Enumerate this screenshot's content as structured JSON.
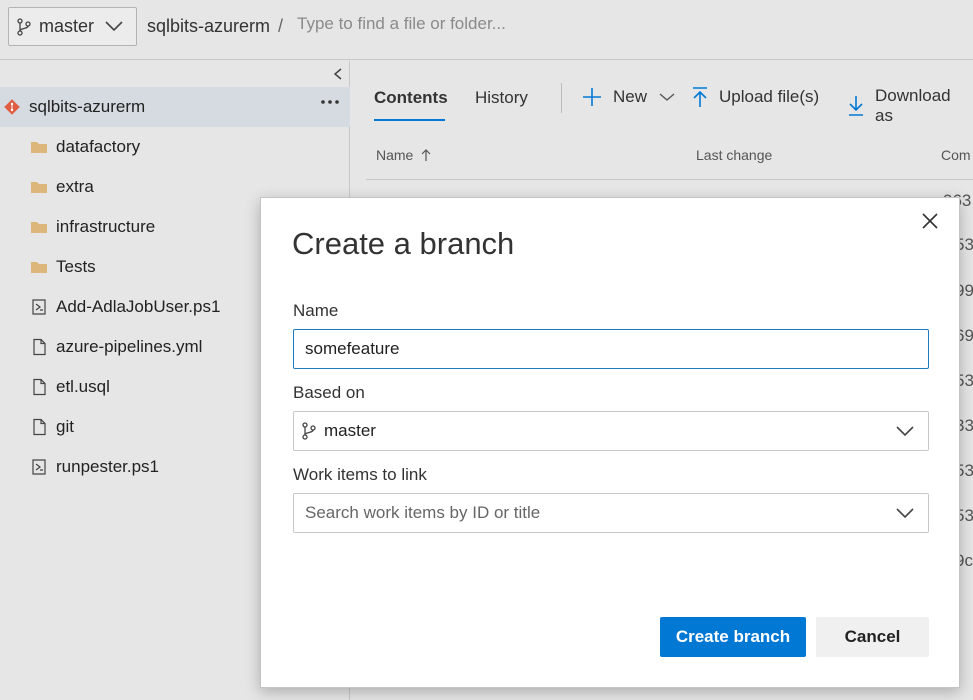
{
  "topbar": {
    "branch_label": "master",
    "repo_name": "sqlbits-azurerm",
    "separator": "/",
    "search_placeholder": "Type to find a file or folder..."
  },
  "sidebar": {
    "root": {
      "label": "sqlbits-azurerm",
      "icon": "git-repo-icon"
    },
    "items": [
      {
        "label": "datafactory",
        "icon": "folder-icon"
      },
      {
        "label": "extra",
        "icon": "folder-icon"
      },
      {
        "label": "infrastructure",
        "icon": "folder-icon"
      },
      {
        "label": "Tests",
        "icon": "folder-icon"
      },
      {
        "label": "Add-AdlaJobUser.ps1",
        "icon": "powershell-file-icon"
      },
      {
        "label": "azure-pipelines.yml",
        "icon": "file-icon"
      },
      {
        "label": "etl.usql",
        "icon": "file-icon"
      },
      {
        "label": "git",
        "icon": "file-icon"
      },
      {
        "label": "runpester.ps1",
        "icon": "powershell-file-icon"
      }
    ]
  },
  "main": {
    "tabs": [
      {
        "label": "Contents"
      },
      {
        "label": "History"
      }
    ],
    "commands": {
      "new": "New",
      "upload": "Upload file(s)",
      "download": "Download as"
    },
    "columns": {
      "name": "Name",
      "last_change": "Last change",
      "commit": "Com"
    },
    "row_fragments": [
      "963",
      "53",
      "99",
      "69",
      "53",
      "33",
      "53",
      "53",
      "9c"
    ]
  },
  "dialog": {
    "title": "Create a branch",
    "name_label": "Name",
    "name_value": "somefeature",
    "based_on_label": "Based on",
    "based_on_value": "master",
    "work_items_label": "Work items to link",
    "work_items_placeholder": "Search work items by ID or title",
    "create_label": "Create branch",
    "cancel_label": "Cancel"
  },
  "colors": {
    "accent": "#0078d4",
    "folder": "#dcb67a",
    "git": "#e05d44"
  }
}
